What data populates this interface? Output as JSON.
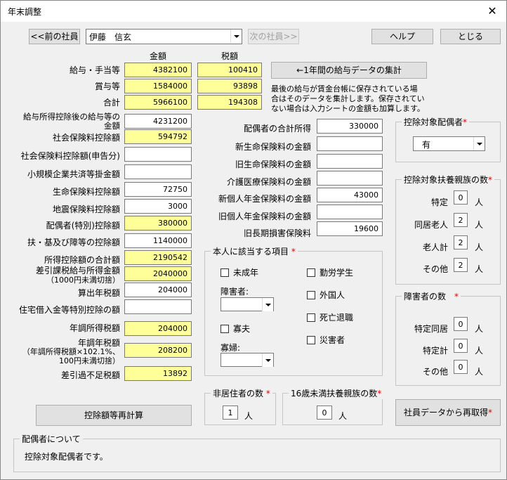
{
  "window": {
    "title": "年末調整",
    "close_glyph": "✕"
  },
  "toolbar": {
    "prev_label": "<<前の社員",
    "employee": "伊藤　信玄",
    "next_label": "次の社員>>",
    "help_label": "ヘルプ",
    "close_label": "とじる"
  },
  "columns": {
    "amount": "金額",
    "tax": "税額"
  },
  "summary": {
    "salary_label": "給与・手当等",
    "salary_amount": "4382100",
    "salary_tax": "100410",
    "bonus_label": "賞与等",
    "bonus_amount": "1584000",
    "bonus_tax": "93898",
    "total_label": "合計",
    "total_amount": "5966100",
    "total_tax": "194308"
  },
  "aggregate": {
    "button_label": "←1年間の給与データの集計",
    "note_line1": "最後の給与が賃金台帳に保存されている場",
    "note_line2": "合はそのデータを集計します。保存されてい",
    "note_line3": "ない場合は入力シートの金額も加算します。"
  },
  "left_fields": [
    {
      "label_line1": "給与所得控除後の給与等の",
      "label_line2": "金額",
      "value": "4231200",
      "yellow": false
    },
    {
      "label": "社会保険料控除額",
      "value": "594792",
      "yellow": true
    },
    {
      "label": "社会保険料控除額(申告分)",
      "value": "",
      "yellow": false
    },
    {
      "label": "小規模企業共済等掛金額",
      "value": "",
      "yellow": false
    },
    {
      "label": "生命保険料控除額",
      "value": "72750",
      "yellow": false
    },
    {
      "label": "地震保険料控除額",
      "value": "3000",
      "yellow": false
    },
    {
      "label": "配偶者(特別)控除額",
      "value": "380000",
      "yellow": true
    },
    {
      "label": "扶・基及び障等の控除額",
      "value": "1140000",
      "yellow": false
    },
    {
      "label": "所得控除額の合計額",
      "value": "2190542",
      "yellow": true
    },
    {
      "label_line1": "差引課税給与所得金額",
      "label_line2": "（1000円未満切捨）",
      "value": "2040000",
      "yellow": true
    },
    {
      "label": "算出年税額",
      "value": "204000",
      "yellow": false
    },
    {
      "label": "住宅借入金等特別控除の額",
      "value": "",
      "yellow": false
    },
    {
      "label": "年調所得税額",
      "value": "204000",
      "yellow": true
    },
    {
      "label_line1": "年調年税額",
      "label_line2": "（年調所得税額×102.1%、",
      "label_line3": "100円未満切捨）",
      "value": "208200",
      "yellow": true
    },
    {
      "label": "差引過不足税額",
      "value": "13892",
      "yellow": true
    }
  ],
  "middle_fields": [
    {
      "label": "配偶者の合計所得",
      "value": "330000"
    },
    {
      "label": "新生命保険料の金額",
      "value": ""
    },
    {
      "label": "旧生命保険料の金額",
      "value": ""
    },
    {
      "label": "介護医療保険料の金額",
      "value": ""
    },
    {
      "label": "新個人年金保険料の金額",
      "value": "43000"
    },
    {
      "label": "旧個人年金保険料の金額",
      "value": ""
    },
    {
      "label": "旧長期損害保険料",
      "value": "19600"
    }
  ],
  "applicable": {
    "title": "本人に該当する項目",
    "minor": "未成年",
    "working_student": "勤労学生",
    "disability": "障害者:",
    "foreigner": "外国人",
    "death_retire": "死亡退職",
    "widower": "寡夫",
    "disaster": "災害者",
    "widow": "寡婦:"
  },
  "spouse_box": {
    "title": "控除対象配偶者",
    "value": "有"
  },
  "dependents": {
    "title": "控除対象扶養親族の数",
    "rows": [
      {
        "label": "特定",
        "value": "0",
        "unit": "人"
      },
      {
        "label": "同居老人",
        "value": "2",
        "unit": "人"
      },
      {
        "label": "老人計",
        "value": "2",
        "unit": "人"
      },
      {
        "label": "その他",
        "value": "2",
        "unit": "人"
      }
    ]
  },
  "disabled_count": {
    "title": "障害者の数",
    "rows": [
      {
        "label": "特定同居",
        "value": "0",
        "unit": "人"
      },
      {
        "label": "特定計",
        "value": "0",
        "unit": "人"
      },
      {
        "label": "その他",
        "value": "0",
        "unit": "人"
      }
    ]
  },
  "nonresident": {
    "title": "非居住者の数",
    "value": "1",
    "unit": "人"
  },
  "under16": {
    "title": "16歳未満扶養親族の数",
    "value": "0",
    "unit": "人"
  },
  "recalc_label": "控除額等再計算",
  "reload_label": "社員データから再取得",
  "spouse_about": {
    "title": "配偶者について",
    "text": "控除対象配偶者です。"
  },
  "required_mark": "*"
}
